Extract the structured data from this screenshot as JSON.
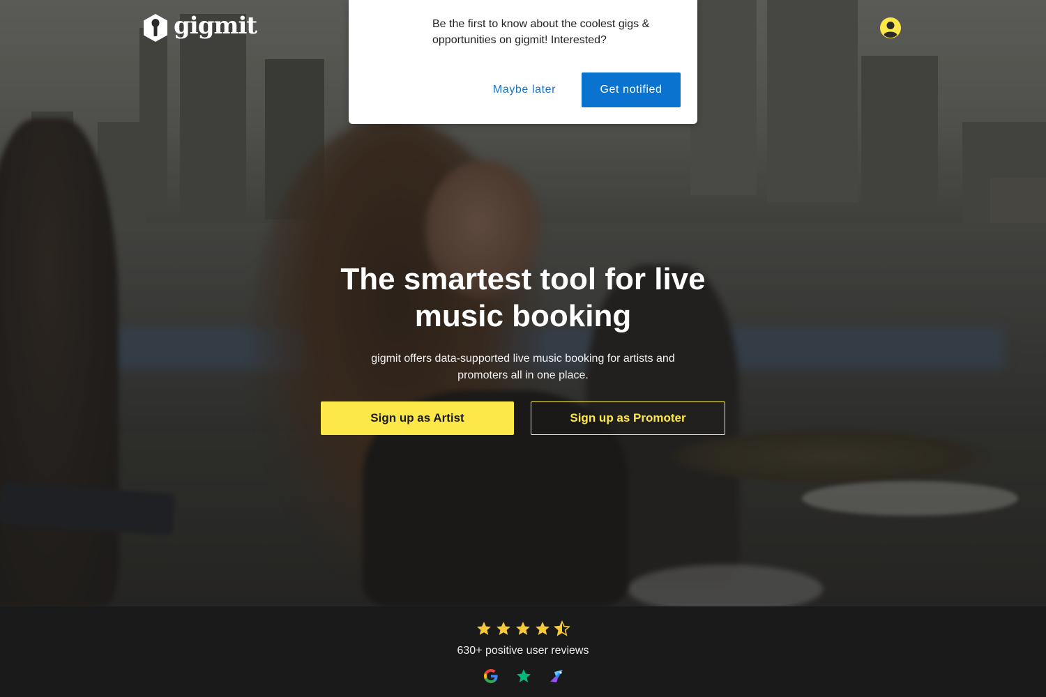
{
  "brand": {
    "name": "gigmit",
    "logo_icon": "microphone-icon"
  },
  "header": {
    "account_icon": "user-circle-icon",
    "accent_color": "#fde84a"
  },
  "notification_prompt": {
    "message": "Be the first to know about the coolest gigs & opportunities on gigmit! Interested?",
    "decline_label": "Maybe later",
    "accept_label": "Get notified",
    "accept_color": "#0a73d0"
  },
  "hero": {
    "title": "The smartest tool for live music booking",
    "subtitle": "gigmit offers data-supported live music booking for artists and promoters all in one place.",
    "primary_cta": "Sign up as Artist",
    "secondary_cta": "Sign up as Promoter",
    "cta_color": "#fde84a"
  },
  "reviews": {
    "rating": 4.5,
    "max_rating": 5,
    "label": "630+ positive user reviews",
    "star_color": "#f5c93a",
    "sources": [
      {
        "icon": "google-icon"
      },
      {
        "icon": "trustpilot-star-icon"
      },
      {
        "icon": "capterra-icon"
      }
    ]
  }
}
